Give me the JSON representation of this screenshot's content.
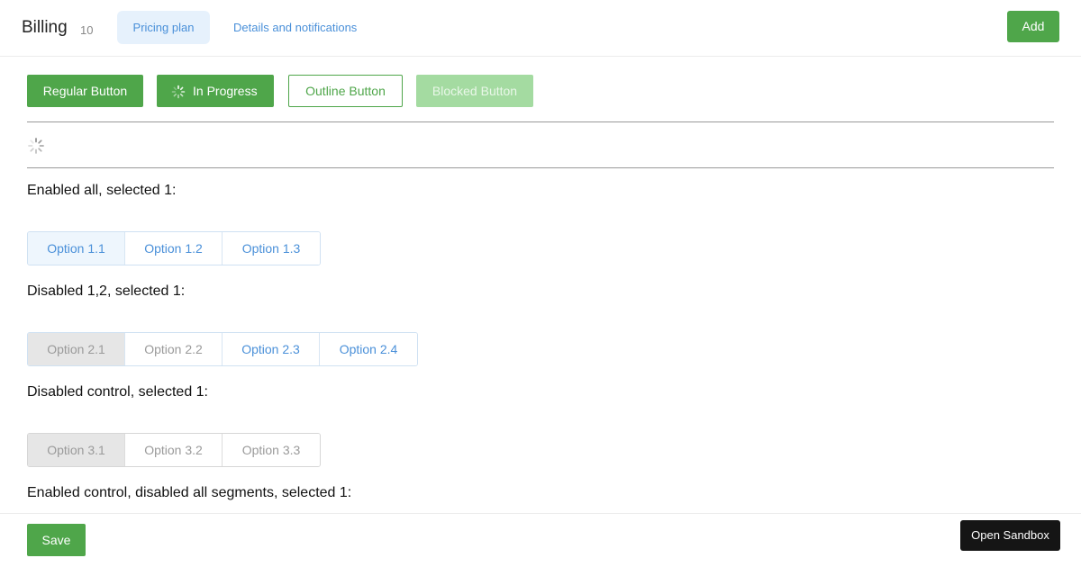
{
  "header": {
    "title": "Billing",
    "count": "10",
    "tabs": [
      {
        "label": "Pricing plan",
        "active": true
      },
      {
        "label": "Details and notifications",
        "active": false
      }
    ],
    "add_label": "Add"
  },
  "buttons": {
    "regular": "Regular Button",
    "progress": "In Progress",
    "outline": "Outline Button",
    "blocked": "Blocked Button"
  },
  "segments": [
    {
      "label": "Enabled all, selected 1:",
      "options": [
        "Option 1.1",
        "Option 1.2",
        "Option 1.3"
      ]
    },
    {
      "label": "Disabled 1,2, selected 1:",
      "options": [
        "Option 2.1",
        "Option 2.2",
        "Option 2.3",
        "Option 2.4"
      ]
    },
    {
      "label": "Disabled control, selected 1:",
      "options": [
        "Option 3.1",
        "Option 3.2",
        "Option 3.3"
      ]
    },
    {
      "label": "Enabled control, disabled all segments, selected 1:"
    }
  ],
  "footer": {
    "save_label": "Save",
    "sandbox_label": "Open Sandbox"
  },
  "colors": {
    "primary_green": "#4fa64a",
    "link_blue": "#4a90d9",
    "selected_bg": "#eef6fd",
    "dark": "#151515"
  },
  "icons": {
    "spinner": "spinner-icon"
  }
}
